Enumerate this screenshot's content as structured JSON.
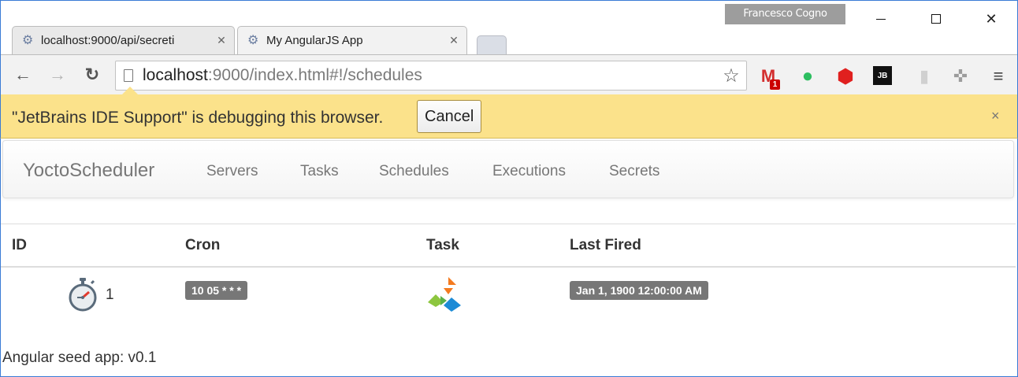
{
  "window": {
    "profile_name": "Francesco Cogno",
    "minimize_label": "minimize",
    "maximize_label": "maximize",
    "close_label": "close"
  },
  "tabs": [
    {
      "title": "localhost:9000/api/secreti",
      "icon": "gear-favicon-icon",
      "close": "✕"
    },
    {
      "title": "My AngularJS App",
      "icon": "gear-favicon-icon",
      "close": "✕"
    }
  ],
  "toolbar": {
    "url_host": "localhost",
    "url_rest": ":9000/index.html#!/schedules",
    "extensions": [
      "gmail-icon",
      "evernote-icon",
      "opera-icon",
      "jetbrains-icon",
      "person-icon",
      "dice-icon",
      "menu-icon"
    ],
    "gmail_badge": "1",
    "jetbrains_text": "JB"
  },
  "infobar": {
    "message": "\"JetBrains IDE Support\" is debugging this browser.",
    "cancel_label": "Cancel",
    "close": "×",
    "color": "#fbe28b"
  },
  "app": {
    "brand": "YoctoScheduler",
    "nav": [
      "Servers",
      "Tasks",
      "Schedules",
      "Executions",
      "Secrets"
    ]
  },
  "table": {
    "headers": [
      "ID",
      "Cron",
      "Task",
      "Last Fired"
    ],
    "rows": [
      {
        "id": "1",
        "cron": "10 05 * * *",
        "task_icon": "task-logo-icon",
        "last_fired": "Jan 1, 1900 12:00:00 AM"
      }
    ]
  },
  "footer": {
    "text": "Angular seed app: v0.1"
  }
}
